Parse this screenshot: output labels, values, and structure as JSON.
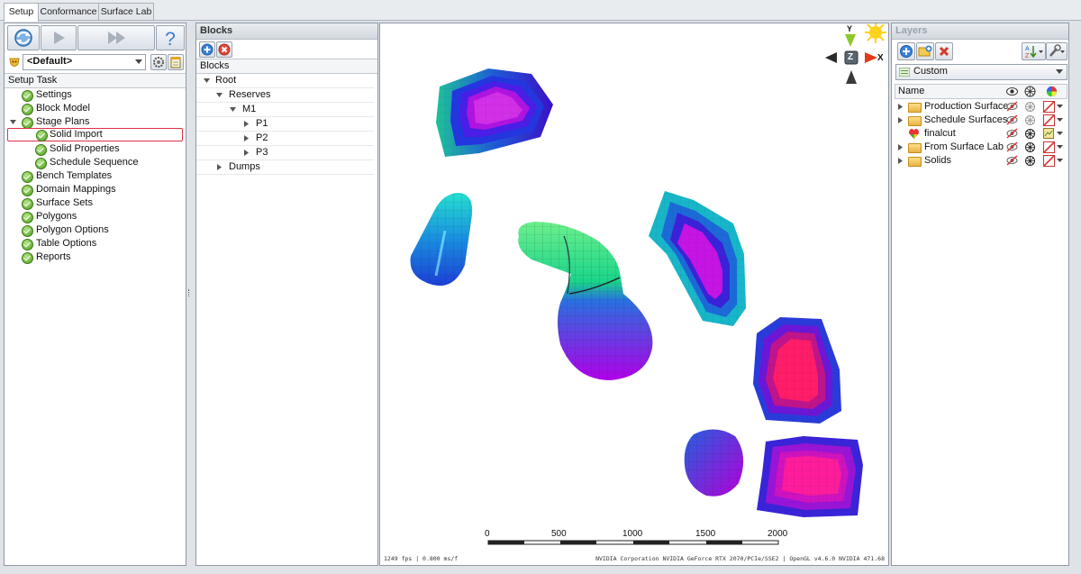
{
  "tabs": [
    {
      "label": "Setup",
      "active": true
    },
    {
      "label": "Conformance",
      "active": false
    },
    {
      "label": "Surface Lab",
      "active": false
    }
  ],
  "left_panel": {
    "scenario_value": "<Default>",
    "section_header": "Setup Task",
    "tasks": [
      {
        "label": "Settings",
        "level": 0
      },
      {
        "label": "Block Model",
        "level": 0
      },
      {
        "label": "Stage Plans",
        "level": 0,
        "expanded": true
      },
      {
        "label": "Solid Import",
        "level": 1,
        "selected": true
      },
      {
        "label": "Solid Properties",
        "level": 1
      },
      {
        "label": "Schedule Sequence",
        "level": 1
      },
      {
        "label": "Bench Templates",
        "level": 0
      },
      {
        "label": "Domain Mappings",
        "level": 0
      },
      {
        "label": "Surface Sets",
        "level": 0
      },
      {
        "label": "Polygons",
        "level": 0
      },
      {
        "label": "Polygon Options",
        "level": 0
      },
      {
        "label": "Table Options",
        "level": 0
      },
      {
        "label": "Reports",
        "level": 0
      }
    ]
  },
  "blocks_panel": {
    "title": "Blocks",
    "column_header": "Blocks",
    "tree": [
      {
        "label": "Root",
        "level": 0,
        "expanded": true
      },
      {
        "label": "Reserves",
        "level": 1,
        "expanded": true
      },
      {
        "label": "M1",
        "level": 2,
        "expanded": true
      },
      {
        "label": "P1",
        "level": 3,
        "expanded": false
      },
      {
        "label": "P2",
        "level": 3,
        "expanded": false
      },
      {
        "label": "P3",
        "level": 3,
        "expanded": false
      },
      {
        "label": "Dumps",
        "level": 1,
        "expanded": false
      }
    ]
  },
  "viewport": {
    "gizmo": {
      "y": "Y",
      "x": "X",
      "z": "Z"
    },
    "scale_labels": [
      "0",
      "500",
      "1000",
      "1500",
      "2000"
    ],
    "status_left": "1249 fps | 0.800 ms/f",
    "status_right": "NVIDIA Corporation NVIDIA GeForce RTX 2070/PCIe/SSE2 | OpenGL v4.6.0 NVIDIA 471.68"
  },
  "layers_panel": {
    "title": "Layers",
    "dropdown_value": "Custom",
    "column_header": "Name",
    "layers": [
      {
        "label": "Production Surfaces",
        "type": "folder"
      },
      {
        "label": "Schedule Surfaces",
        "type": "folder"
      },
      {
        "label": "finalcut",
        "type": "surface"
      },
      {
        "label": "From Surface Lab",
        "type": "folder"
      },
      {
        "label": "Solids",
        "type": "folder"
      }
    ]
  },
  "colors": {
    "selection_border": "#e0304a",
    "panel_border": "#8e98a3"
  }
}
